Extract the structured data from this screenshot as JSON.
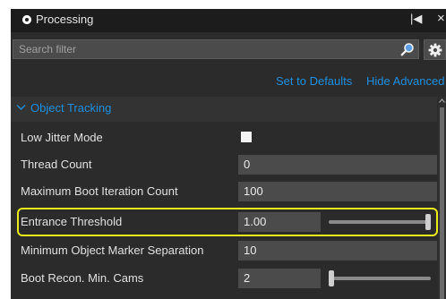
{
  "window": {
    "title": "Processing",
    "collapse_glyph": "|◀",
    "close_glyph": "×",
    "icons": [
      "radio-dot-icon",
      "collapse-icon",
      "close-icon"
    ]
  },
  "search": {
    "placeholder": "Search filter",
    "value": "",
    "icon": "search-icon",
    "settings_icon": "gear-icon"
  },
  "links": {
    "set_defaults": "Set to Defaults",
    "hide_advanced": "Hide Advanced"
  },
  "section": {
    "label": "Object Tracking",
    "expanded": true
  },
  "rows": [
    {
      "label": "Low Jitter Mode",
      "type": "checkbox",
      "checked": true
    },
    {
      "label": "Thread Count",
      "type": "number",
      "value": "0"
    },
    {
      "label": "Maximum Boot Iteration Count",
      "type": "number",
      "value": "100"
    },
    {
      "label": "Entrance Threshold",
      "type": "slider",
      "value": "1.00",
      "slider_fraction": 1.0,
      "highlighted": true
    },
    {
      "label": "Minimum Object Marker Separation",
      "type": "number",
      "value": "10"
    },
    {
      "label": "Boot Recon. Min. Cams",
      "type": "slider",
      "value": "2",
      "slider_fraction": 0.0
    }
  ],
  "colors": {
    "panel_bg": "#2b2b2b",
    "titlebar_bg": "#1c1c1c",
    "field_bg": "#4b4b4b",
    "accent_link": "#1e8fe0",
    "highlight": "#eaea1a"
  }
}
